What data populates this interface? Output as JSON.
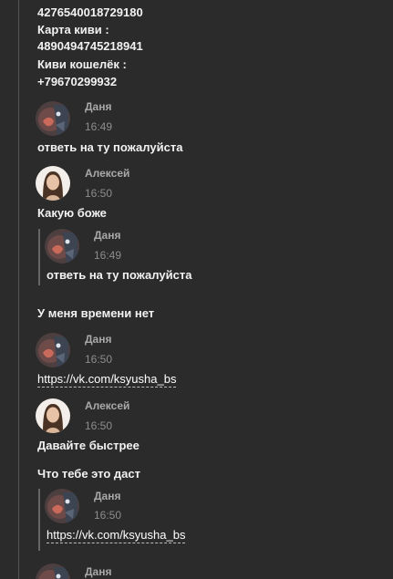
{
  "top_lines": [
    "4276540018729180",
    "Карта киви :",
    "4890494745218941",
    "Киви кошелёк :",
    "+79670299932"
  ],
  "messages": [
    {
      "author": "Даня",
      "time": "16:49",
      "text": "ответь на ту пожалуйста"
    },
    {
      "author": "Алексей",
      "time": "16:50",
      "text": "Какую боже",
      "quote": {
        "author": "Даня",
        "time": "16:49",
        "text": "ответь на ту пожалуйста"
      },
      "after_quote": "У меня времени нет"
    },
    {
      "author": "Даня",
      "time": "16:50",
      "link": "https://vk.com/ksyusha_bs"
    },
    {
      "author": "Алексей",
      "time": "16:50",
      "text": "Давайте быстрее",
      "text2": "Что тебе это даст",
      "quote": {
        "author": "Даня",
        "time": "16:50",
        "link": "https://vk.com/ksyusha_bs"
      }
    },
    {
      "author": "Даня"
    }
  ],
  "colors": {
    "background": "#2b2b2b",
    "text": "#f2f2f2",
    "name": "#a9a9a9",
    "time": "#8d8d8d",
    "quote_bar": "#666666"
  },
  "icons": {
    "danya_avatar": "anime-avatar",
    "aleksey_avatar": "portrait-avatar"
  }
}
